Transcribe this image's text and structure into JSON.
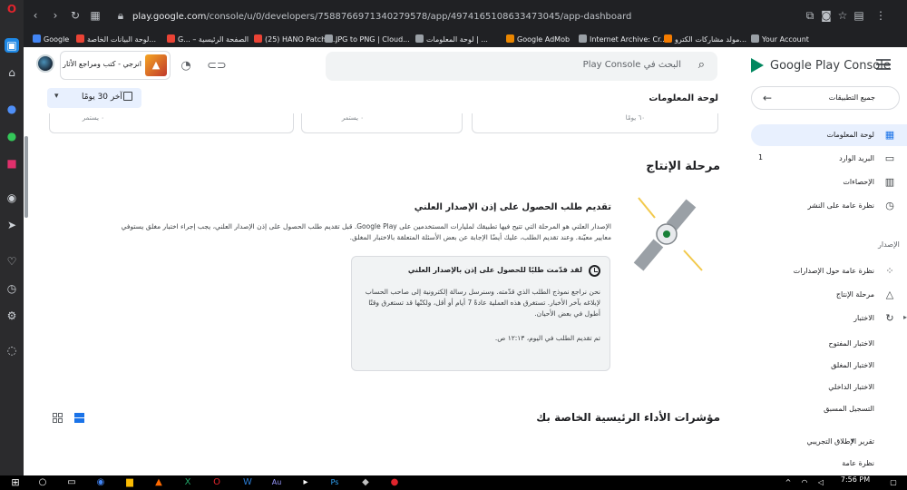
{
  "browser": {
    "url_host": "play.google.com",
    "url_path": "/console/u/0/developers/7588766971340279578/app/4974165108633473045/app-dashboard",
    "bookmarks": [
      {
        "label": "Google",
        "color": "#4285f4"
      },
      {
        "label": "لوحة البيانات الخاصة...",
        "color": "#ea4335"
      },
      {
        "label": "G... – الصفحة الرئيسية",
        "color": "#ea4335"
      },
      {
        "label": "(25) HANO Patch 4...",
        "color": "#ea4335"
      },
      {
        "label": "JPG to PNG | Cloud...",
        "color": "#e8eaed"
      },
      {
        "label": "لوحة المعلومات | ...",
        "color": "#e8eaed"
      },
      {
        "label": "Google AdMob",
        "color": "#ea8600"
      },
      {
        "label": "Internet Archive: Cr...",
        "color": "#e8eaed"
      },
      {
        "label": "مولد مشاركات الكترو...",
        "color": "#f57c00"
      },
      {
        "label": "Your Account",
        "color": "#e8eaed"
      }
    ]
  },
  "header": {
    "brand": "Google Play Console",
    "search_placeholder": "البحث في Play Console",
    "developer_name": "انرجي - كتب ومراجع الأثار"
  },
  "sidebar": {
    "all_apps": "جميع التطبيقات",
    "items": [
      {
        "label": "لوحة المعلومات",
        "icon": "dashboard-icon",
        "active": true
      },
      {
        "label": "البريد الوارد",
        "icon": "inbox-icon",
        "badge": "1"
      },
      {
        "label": "الإحصاءات",
        "icon": "bar-chart-icon"
      },
      {
        "label": "نظرة عامة على النشر",
        "icon": "publishing-icon"
      }
    ],
    "section_label": "الإصدار",
    "release_items": [
      {
        "label": "نظرة عامة حول الإصدارات",
        "icon": "releases-icon"
      },
      {
        "label": "مرحلة الإنتاج",
        "icon": "production-icon"
      },
      {
        "label": "الاختبار",
        "icon": "testing-icon",
        "expandable": true
      }
    ],
    "testing_subitems": [
      "الاختبار المفتوح",
      "الاختبار المغلق",
      "الاختبار الداخلي",
      "التسجيل المسبق"
    ],
    "prelaunch": {
      "label": "تقرير الإطلاق التجريبي"
    },
    "prelaunch_sub": "نظرة عامة"
  },
  "main": {
    "page_title": "لوحة المعلومات",
    "date_range": "آخر 30 يومًا",
    "card_snippets": [
      "٦٠ يومًا",
      "٠ يستمر",
      "٠ يستمر"
    ],
    "production_heading": "مرحلة الإنتاج",
    "request_title": "تقديم طلب الحصول على إذن الإصدار العلني",
    "request_desc": "الإصدار العلني هو المرحلة التي تتيح فيها تطبيقك لمليارات المستخدمين على Google Play. قبل تقديم طلب الحصول على إذن الإصدار العلني، يجب إجراء اختبار مغلق يستوفي معايير معيّنة. وعند تقديم الطلب، عليك أيضًا الإجابة عن بعض الأسئلة المتعلقة بالاختبار المغلق.",
    "notice_title": "لقد قدّمت طلبًا للحصول على إذن بالإصدار العلني",
    "notice_body": "نحن نراجع نموذج الطلب الذي قدّمته. وسنرسل رسالة إلكترونية إلى صاحب الحساب لإبلاغه بآخر الأخبار. تستغرق هذه العملية عادةً 7 أيام أو أقل، ولكنّها قد تستغرق وقتًا أطول في بعض الأحيان.",
    "notice_submitted": "تم تقديم الطلب في اليوم، ١٢:١٣ ص.",
    "kpi_heading": "مؤشرات الأداء الرئيسية الخاصة بك"
  },
  "taskbar": {
    "time": "7:56 PM",
    "date": ""
  }
}
